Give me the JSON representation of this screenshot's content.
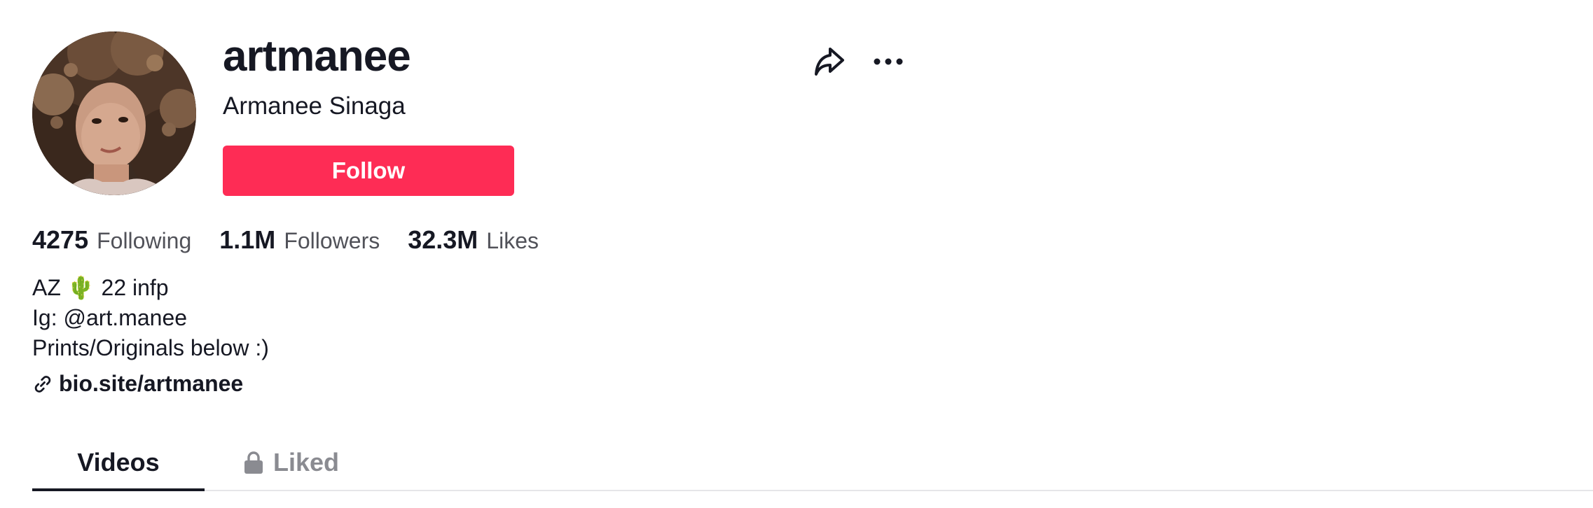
{
  "profile": {
    "username": "artmanee",
    "display_name": "Armanee Sinaga",
    "follow_label": "Follow"
  },
  "header_actions": {
    "share_icon": "share-arrow-icon",
    "more_icon": "ellipsis-icon"
  },
  "stats": [
    {
      "value": "4275",
      "label": "Following"
    },
    {
      "value": "1.1M",
      "label": "Followers"
    },
    {
      "value": "32.3M",
      "label": "Likes"
    }
  ],
  "bio": {
    "lines": [
      "AZ 🌵 22 infp",
      "Ig: @art.manee",
      "Prints/Originals below :)"
    ],
    "link_icon": "link-icon",
    "link_text": "bio.site/artmanee"
  },
  "tabs": [
    {
      "label": "Videos",
      "active": true
    },
    {
      "label": "Liked",
      "active": false,
      "icon": "lock-icon"
    }
  ],
  "colors": {
    "accent": "#fe2c55",
    "text_primary": "#161823",
    "text_secondary": "#515259",
    "tab_inactive": "#8a8b91"
  }
}
